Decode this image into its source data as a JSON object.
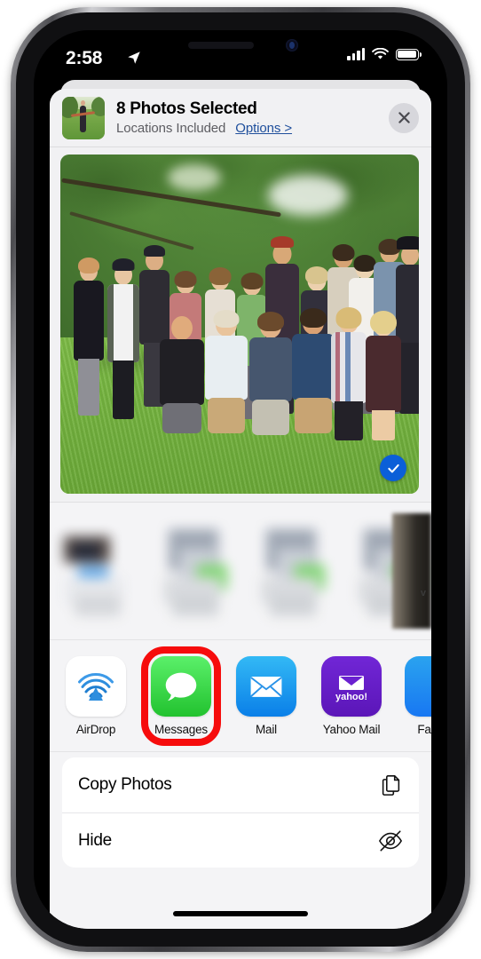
{
  "status_bar": {
    "time": "2:58",
    "location_icon": "location-arrow-icon",
    "signal_icon": "cellular-signal-icon",
    "wifi_icon": "wifi-icon",
    "battery_icon": "battery-full-icon"
  },
  "share_sheet": {
    "title": "8 Photos Selected",
    "subtitle": "Locations Included",
    "options_link": "Options >",
    "close_icon": "close-icon",
    "thumbnail_name": "selected-photo-thumbnail"
  },
  "carousel": {
    "selected_badge_icon": "checkmark-circle-icon",
    "main_photo_name": "group-photo-outdoors"
  },
  "suggestions": {
    "note": "blurred-contact-suggestions",
    "edge_label": "v"
  },
  "apps": [
    {
      "label": "AirDrop",
      "icon": "airdrop-icon",
      "highlighted": false
    },
    {
      "label": "Messages",
      "icon": "messages-icon",
      "highlighted": true
    },
    {
      "label": "Mail",
      "icon": "mail-icon",
      "highlighted": false
    },
    {
      "label": "Yahoo Mail",
      "icon": "yahoo-mail-icon",
      "highlighted": false
    },
    {
      "label": "Fa",
      "icon": "facebook-icon",
      "highlighted": false
    }
  ],
  "actions": [
    {
      "label": "Copy Photos",
      "icon": "copy-icon"
    },
    {
      "label": "Hide",
      "icon": "eye-slash-icon"
    }
  ],
  "colors": {
    "accent_blue": "#0b5fd8",
    "link_blue": "#1f4f9c",
    "highlight_red": "#f60c0c",
    "sheet_bg": "#f1f1f3",
    "messages_green": "#22c22f"
  }
}
